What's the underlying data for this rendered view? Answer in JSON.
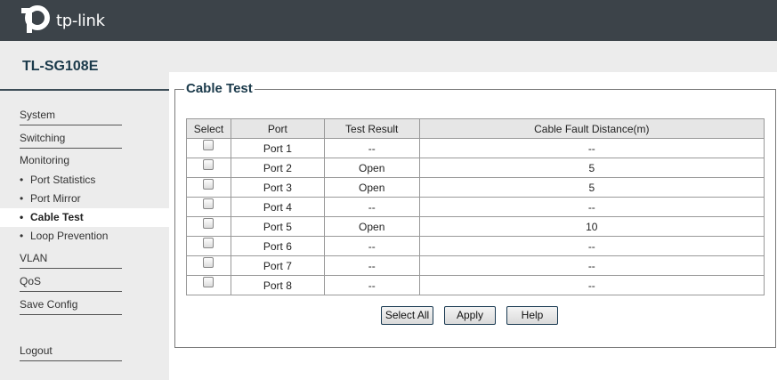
{
  "header": {
    "logo_text": "tp-link"
  },
  "model": "TL-SG108E",
  "sidebar": {
    "system": "System",
    "switching": "Switching",
    "monitoring": "Monitoring",
    "sub_items": [
      "Port Statistics",
      "Port Mirror",
      "Cable Test",
      "Loop Prevention"
    ],
    "vlan": "VLAN",
    "qos": "QoS",
    "save_config": "Save Config",
    "logout": "Logout",
    "bullet": "•"
  },
  "panel": {
    "title": "Cable Test",
    "columns": [
      "Select",
      "Port",
      "Test Result",
      "Cable Fault Distance(m)"
    ],
    "rows": [
      {
        "port": "Port 1",
        "result": "--",
        "distance": "--"
      },
      {
        "port": "Port 2",
        "result": "Open",
        "distance": "5"
      },
      {
        "port": "Port 3",
        "result": "Open",
        "distance": "5"
      },
      {
        "port": "Port 4",
        "result": "--",
        "distance": "--"
      },
      {
        "port": "Port 5",
        "result": "Open",
        "distance": "10"
      },
      {
        "port": "Port 6",
        "result": "--",
        "distance": "--"
      },
      {
        "port": "Port 7",
        "result": "--",
        "distance": "--"
      },
      {
        "port": "Port 8",
        "result": "--",
        "distance": "--"
      }
    ],
    "buttons": {
      "select_all": "Select All",
      "apply": "Apply",
      "help": "Help"
    }
  },
  "colors": {
    "header_bg": "#3c4349",
    "sidebar_bg": "#ececec",
    "title_color": "#1b3a4b"
  },
  "icons": {
    "logo": "tp-link-logo-icon"
  }
}
